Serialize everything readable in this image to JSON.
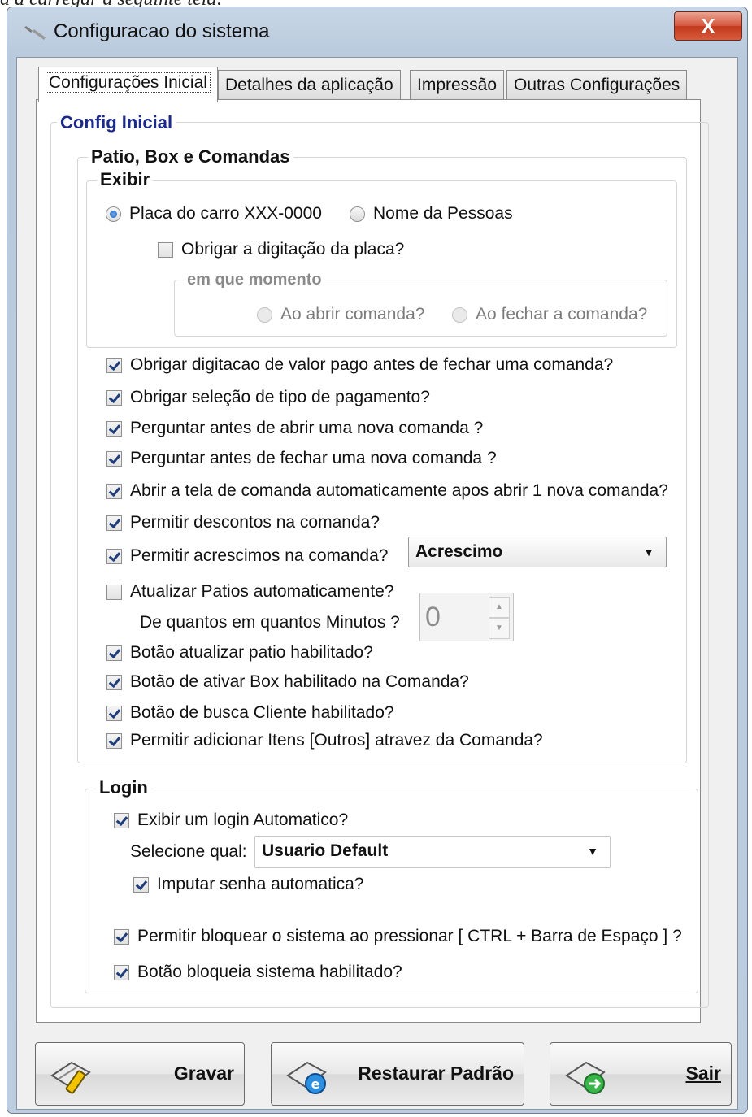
{
  "caption": "a a carregar a seguinte tela:",
  "window": {
    "title": "Configuracao do sistema",
    "close_label": "X"
  },
  "tabs": [
    "Configurações Inicial",
    "Detalhes da aplicação",
    "Impressão",
    "Outras Configurações"
  ],
  "config_inicial": {
    "legend": "Config Inicial",
    "patio": {
      "legend": "Patio, Box e Comandas",
      "exibir": {
        "legend": "Exibir",
        "radio_placa": "Placa do carro XXX-0000",
        "radio_nome": "Nome da Pessoas",
        "obrigar_placa": "Obrigar a digitação da placa?",
        "momento": {
          "legend": "em que momento",
          "radio_abrir": "Ao abrir comanda?",
          "radio_fechar": "Ao fechar a comanda?"
        }
      },
      "options": {
        "o1": "Obrigar digitacao de valor pago antes de fechar uma comanda?",
        "o2": "Obrigar seleção de tipo de pagamento?",
        "o3": "Perguntar antes de abrir uma nova comanda ?",
        "o4": "Perguntar antes de fechar uma nova comanda ?",
        "o5": "Abrir a tela de comanda automaticamente apos abrir 1 nova comanda?",
        "o6": "Permitir descontos na comanda?",
        "o7": "Permitir acrescimos na comanda?",
        "o8": "Atualizar Patios automaticamente?",
        "o9": "Botão atualizar patio habilitado?",
        "o10": "Botão de ativar Box habilitado na Comanda?",
        "o11": "Botão de busca Cliente habilitado?",
        "o12": "Permitir adicionar Itens [Outros] atravez da Comanda?"
      },
      "acrescimo_select": "Acrescimo",
      "minutos_label": "De quantos em quantos Minutos ?",
      "minutos_value": "0"
    },
    "login": {
      "legend": "Login",
      "exibir_login": "Exibir um login Automatico?",
      "selecione_label": "Selecione qual:",
      "usuario_select": "Usuario Default",
      "imputar_senha": "Imputar senha automatica?",
      "bloquear": "Permitir bloquear o sistema ao pressionar [ CTRL + Barra de Espaço ] ?",
      "botao_bloqueia": "Botão bloqueia sistema habilitado?"
    }
  },
  "buttons": {
    "gravar": "Gravar",
    "restaurar": "Restaurar Padrão",
    "sair": "Sair"
  },
  "colors": {
    "legend_blue": "#1b2a8a",
    "check": "#1f3d7a",
    "close_red": "#c0391d"
  }
}
